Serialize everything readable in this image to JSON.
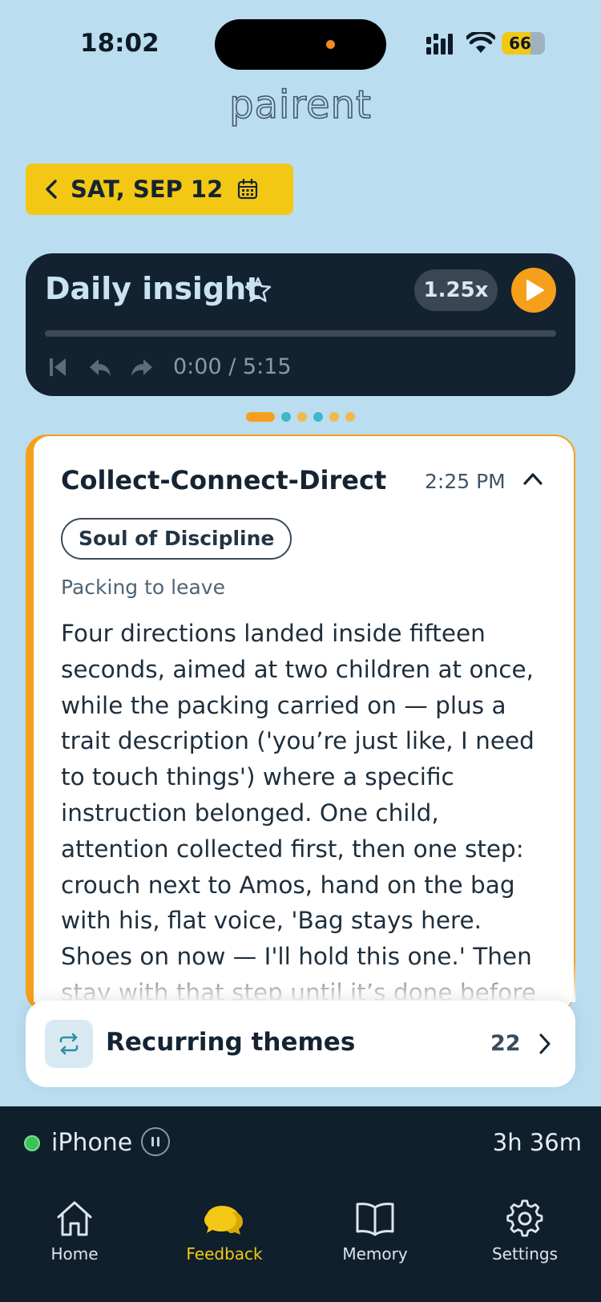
{
  "status_bar": {
    "time": "18:02",
    "battery": "66",
    "battery_level": 0.66
  },
  "app": {
    "logo": "pairent"
  },
  "date_selector": {
    "label": "SAT, SEP 12"
  },
  "audio_player": {
    "title": "Daily insight",
    "speed": "1.25x",
    "time": "0:00 / 5:15",
    "progress_fraction": 0.0
  },
  "pager": {
    "count": 6,
    "active_index": 0,
    "colors": [
      "#F5A01A",
      "#3FB6C9",
      "#F2B84A",
      "#3FB6C9",
      "#F2B84A",
      "#F2B84A"
    ]
  },
  "feedback_card": {
    "title": "Collect-Connect-Direct",
    "time": "2:25 PM",
    "tag": "Soul of Discipline",
    "subtitle": "Packing to leave",
    "body": "Four directions landed inside fifteen seconds, aimed at two children at once, while the packing carried on — plus a trait description ('you’re just like, I need to touch things') where a specific instruction belonged. One child, attention collected first, then one step: crouch next to Amos, hand on the bag with his, flat voice, 'Bag stays here. Shoes on now — I'll hold this one.' Then stay with that step until it’s done before starting the next one.",
    "accent_color": "#F5A01A"
  },
  "recurring_themes": {
    "label": "Recurring themes",
    "count": "22"
  },
  "device_status": {
    "name": "iPhone",
    "duration": "3h 36m",
    "status_color": "#3BC35A"
  },
  "tab_bar": {
    "tabs": [
      {
        "label": "Home",
        "icon": "home-icon"
      },
      {
        "label": "Feedback",
        "icon": "chat-bubbles-icon"
      },
      {
        "label": "Memory",
        "icon": "book-icon"
      },
      {
        "label": "Settings",
        "icon": "gear-icon"
      }
    ],
    "active_index": 1,
    "active_color": "#F2C814"
  }
}
